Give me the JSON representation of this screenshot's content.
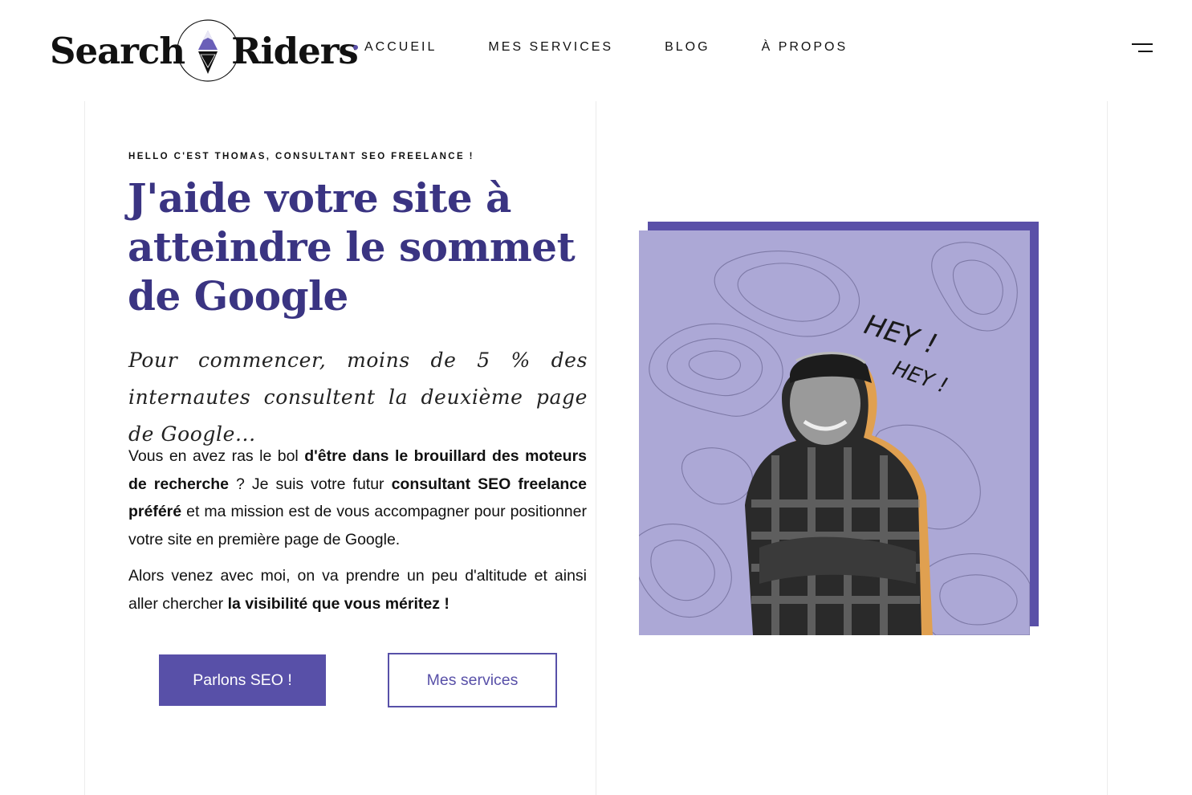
{
  "header": {
    "logo": {
      "word_left": "Search",
      "word_right": "Riders"
    },
    "nav": [
      {
        "label": "ACCUEIL",
        "active": true
      },
      {
        "label": "MES SERVICES",
        "active": false
      },
      {
        "label": "BLOG",
        "active": false
      },
      {
        "label": "À PROPOS",
        "active": false
      }
    ],
    "menu_icon": "hamburger-icon"
  },
  "hero": {
    "eyebrow": "HELLO C'EST THOMAS, CONSULTANT SEO FREELANCE !",
    "headline": "J'aide votre site à atteindre le sommet de Google",
    "script_line": "Pour commencer, moins de 5 % des internautes consultent la deuxième page de Google...",
    "paragraph1": [
      {
        "text": "Vous en avez ras le bol ",
        "bold": false
      },
      {
        "text": "d'être dans le brouillard des moteurs de recherche",
        "bold": true
      },
      {
        "text": " ? Je suis votre futur ",
        "bold": false
      },
      {
        "text": "consultant SEO freelance préféré",
        "bold": true
      },
      {
        "text": " et ma mission est de vous accompagner pour positionner votre site en première page de Google.",
        "bold": false
      }
    ],
    "paragraph2": [
      {
        "text": "Alors venez avec moi, on va prendre un peu d'altitude et ainsi aller chercher ",
        "bold": false
      },
      {
        "text": "la visibilité que vous méritez !",
        "bold": true
      }
    ],
    "buttons": {
      "primary": "Parlons SEO !",
      "secondary": "Mes services"
    },
    "photo": {
      "hey_1": "HEY !",
      "hey_2": "HEY !"
    }
  },
  "colors": {
    "accent": "#5850a8",
    "headline": "#3a3482",
    "photo_bg": "#aca8d6",
    "logo_peak": "#6a5fb8"
  }
}
